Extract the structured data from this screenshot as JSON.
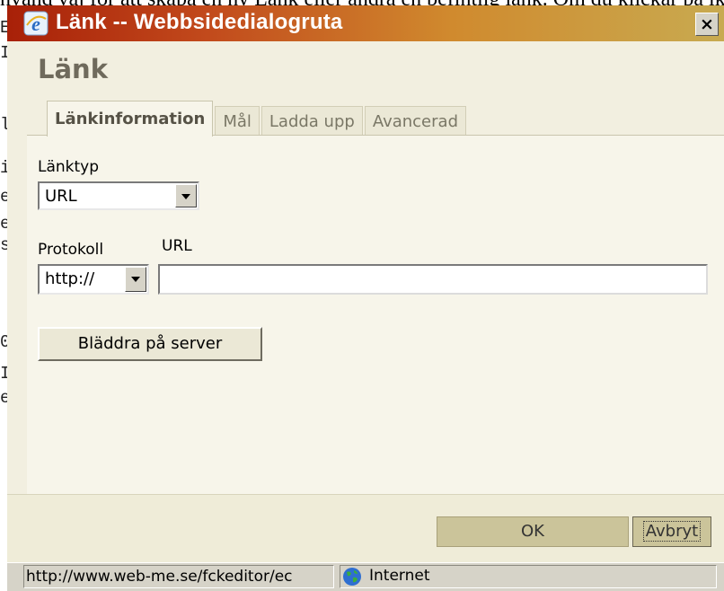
{
  "background_page": {
    "top_text": "nvänd vaj för att skapa en ny Länk eller ändra en befintlig länk. Om du klickar på ikonen så öppnas ja",
    "left_fragments": [
      "E",
      "I",
      "l",
      "i",
      "e",
      "e",
      "s",
      "0",
      "I",
      "e"
    ]
  },
  "window": {
    "title": "Länk -- Webbsidedialogruta",
    "close_symbol": "×"
  },
  "dialog": {
    "header": "Länk",
    "tabs": [
      {
        "label": "Länkinformation",
        "active": true
      },
      {
        "label": "Mål",
        "active": false
      },
      {
        "label": "Ladda upp",
        "active": false
      },
      {
        "label": "Avancerad",
        "active": false
      }
    ]
  },
  "form": {
    "link_type_label": "Länktyp",
    "link_type_value": "URL",
    "protocol_label": "Protokoll",
    "protocol_value": "http://",
    "url_label": "URL",
    "url_value": "",
    "browse_button": "Bläddra på server"
  },
  "footer": {
    "ok_label": "OK",
    "cancel_label": "Avbryt"
  },
  "statusbar": {
    "url": "http://www.web-me.se/fckeditor/ec",
    "zone": "Internet"
  },
  "colors": {
    "title_gradient_start": "#a82008",
    "title_gradient_end": "#c8aa50",
    "dialog_background": "#f2efe0",
    "button_accent": "#cbc49a"
  }
}
